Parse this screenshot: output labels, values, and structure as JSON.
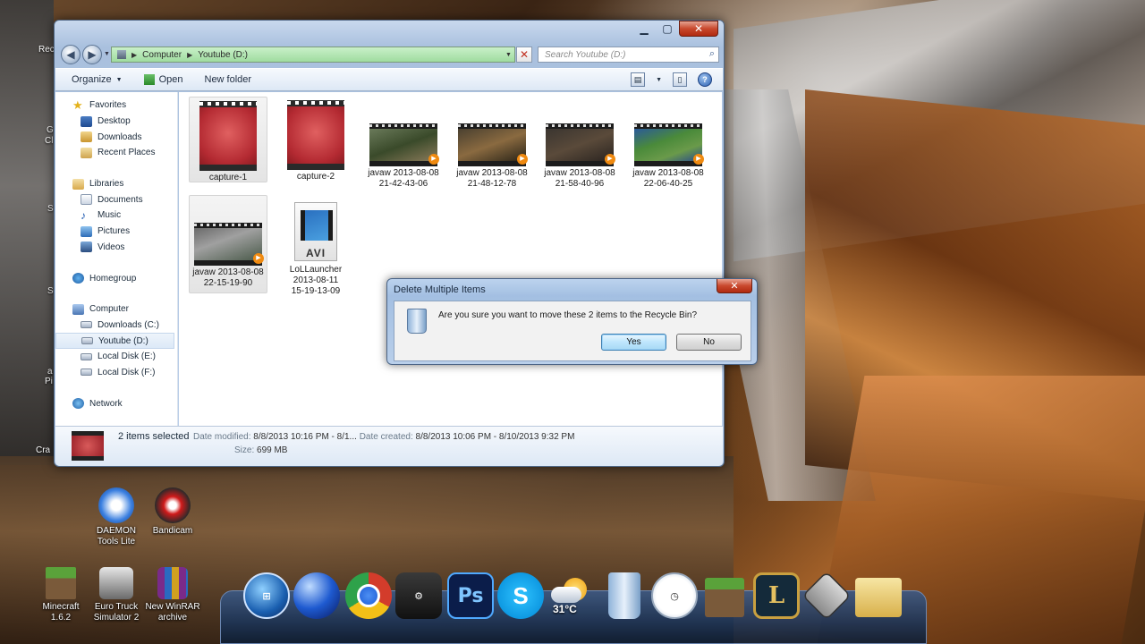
{
  "desktop": {
    "edge_labels": [
      "Rec",
      "G",
      "Cl",
      "S",
      "S",
      "a",
      "Pi",
      "Cra"
    ],
    "icons": [
      {
        "label_line1": "DAEMON",
        "label_line2": "Tools Lite",
        "icon": "daemon-tools-icon"
      },
      {
        "label_line1": "Bandicam",
        "label_line2": "",
        "icon": "bandicam-icon"
      },
      {
        "label_line1": "Minecraft",
        "label_line2": "1.6.2",
        "icon": "minecraft-icon"
      },
      {
        "label_line1": "Euro Truck",
        "label_line2": "Simulator 2",
        "icon": "euro-truck-icon"
      },
      {
        "label_line1": "New WinRAR",
        "label_line2": "archive",
        "icon": "winrar-icon"
      }
    ]
  },
  "explorer": {
    "breadcrumb": [
      "Computer",
      "Youtube (D:)"
    ],
    "search_placeholder": "Search Youtube (D:)",
    "toolbar": {
      "organize": "Organize",
      "open": "Open",
      "new_folder": "New folder"
    },
    "nav": {
      "favorites": "Favorites",
      "desktop": "Desktop",
      "downloads": "Downloads",
      "recent": "Recent Places",
      "libraries": "Libraries",
      "documents": "Documents",
      "music": "Music",
      "pictures": "Pictures",
      "videos": "Videos",
      "homegroup": "Homegroup",
      "computer": "Computer",
      "drive_c": "Downloads (C:)",
      "drive_d": "Youtube (D:)",
      "drive_e": "Local Disk (E:)",
      "drive_f": "Local Disk (F:)",
      "network": "Network"
    },
    "files": [
      {
        "name1": "capture-1",
        "name2": "",
        "selected": true
      },
      {
        "name1": "capture-2",
        "name2": "",
        "selected": false
      },
      {
        "name1": "javaw 2013-08-08",
        "name2": "21-42-43-06",
        "selected": false
      },
      {
        "name1": "javaw 2013-08-08",
        "name2": "21-48-12-78",
        "selected": false
      },
      {
        "name1": "javaw 2013-08-08",
        "name2": "21-58-40-96",
        "selected": false
      },
      {
        "name1": "javaw 2013-08-08",
        "name2": "22-06-40-25",
        "selected": false
      },
      {
        "name1": "javaw 2013-08-08",
        "name2": "22-15-19-90",
        "selected": true
      },
      {
        "name1": "LoLLauncher",
        "name2": "2013-08-11",
        "name3": "15-19-13-09",
        "ext": "AVI",
        "selected": false
      }
    ],
    "details": {
      "selection": "2 items selected",
      "date_modified_label": "Date modified:",
      "date_modified": "8/8/2013 10:16 PM - 8/1...",
      "date_created_label": "Date created:",
      "date_created": "8/8/2013 10:06 PM - 8/10/2013 9:32 PM",
      "size_label": "Size:",
      "size": "699 MB"
    }
  },
  "dialog": {
    "title": "Delete Multiple Items",
    "message": "Are you sure you want to move these 2 items to the Recycle Bin?",
    "yes": "Yes",
    "no": "No"
  },
  "dock": {
    "weather_temp": "31°C",
    "photoshop": "Ps",
    "league": "L"
  }
}
